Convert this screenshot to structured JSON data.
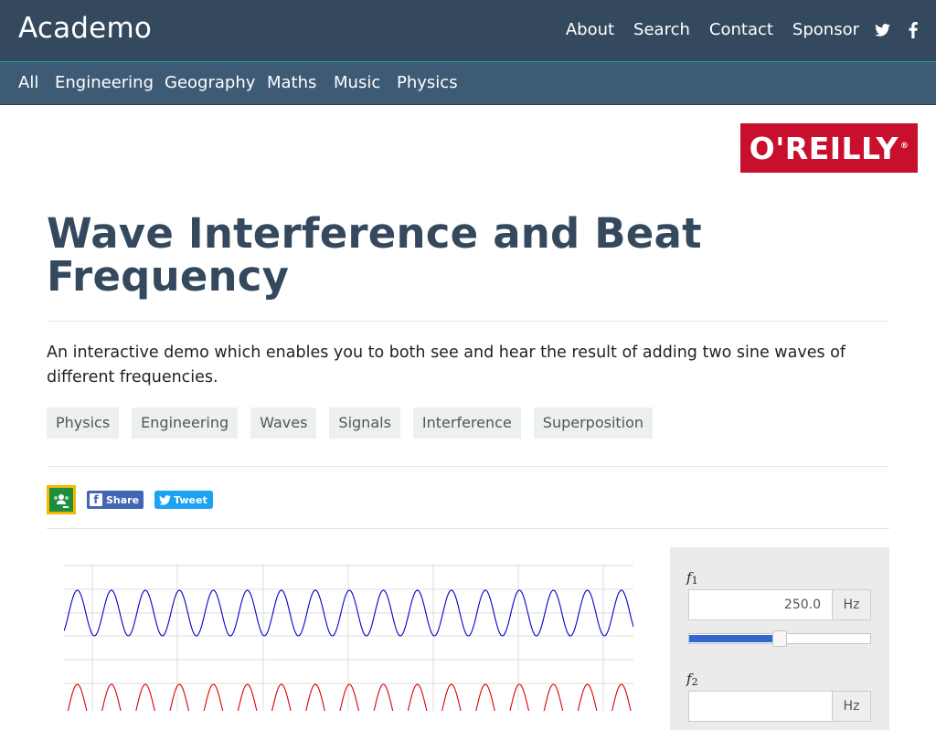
{
  "header": {
    "brand": "Academo",
    "nav": [
      {
        "label": "About"
      },
      {
        "label": "Search"
      },
      {
        "label": "Contact"
      },
      {
        "label": "Sponsor"
      }
    ],
    "social": [
      {
        "name": "twitter-icon"
      },
      {
        "name": "facebook-icon"
      }
    ]
  },
  "categories": [
    "All",
    "Engineering",
    "Geography",
    "Maths",
    "Music",
    "Physics"
  ],
  "ad": {
    "logo_text": "O'REILLY",
    "reg_mark": "®",
    "color": "#c8102e"
  },
  "page": {
    "title": "Wave Interference and Beat Frequency",
    "description": "An interactive demo which enables you to both see and hear the result of adding two sine waves of different frequencies.",
    "tags": [
      "Physics",
      "Engineering",
      "Waves",
      "Signals",
      "Interference",
      "Superposition"
    ]
  },
  "share": {
    "facebook_label": "Share",
    "twitter_label": "Tweet"
  },
  "controls": {
    "f1": {
      "label": "f",
      "sub": "1",
      "value": "250.0",
      "unit": "Hz",
      "slider_fraction": 0.5
    },
    "f2": {
      "label": "f",
      "sub": "2",
      "value": "",
      "unit": "Hz"
    }
  },
  "colors": {
    "header_bg": "#34495e",
    "category_bg": "#3e5b75",
    "title": "#34495e",
    "wave1": "#0000cc",
    "wave2": "#dd0000",
    "slider_fill": "#3366cc"
  }
}
